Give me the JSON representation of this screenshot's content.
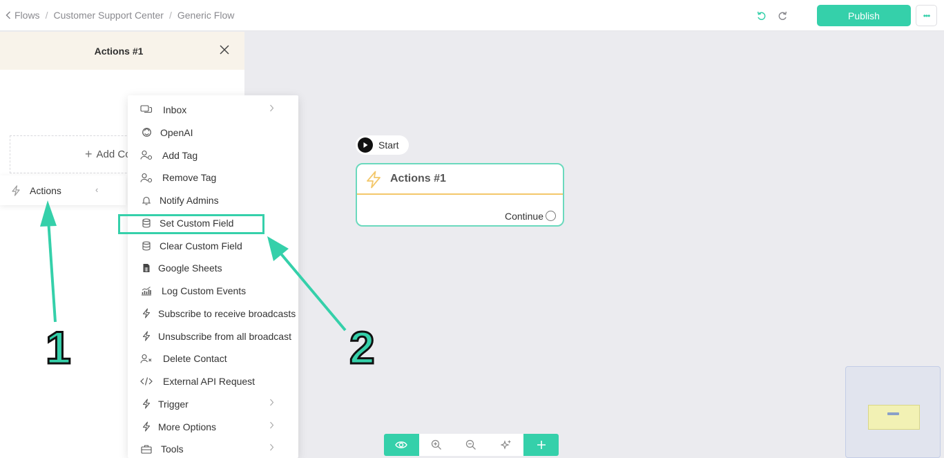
{
  "breadcrumb": {
    "back_label": "Flows",
    "items": [
      "Customer Support Center",
      "Generic Flow"
    ],
    "separator": "/"
  },
  "topbar": {
    "publish_label": "Publish",
    "more_glyph": "•••"
  },
  "panel": {
    "title": "Actions #1",
    "add_content_label": "Add Co",
    "actions_item_label": "Actions"
  },
  "menu": {
    "items": [
      {
        "label": "Inbox",
        "icon": "chat-bubbles-icon",
        "submenu": true
      },
      {
        "label": "OpenAI",
        "icon": "openai-icon",
        "submenu": false
      },
      {
        "label": "Add Tag",
        "icon": "user-tag-icon",
        "submenu": false
      },
      {
        "label": "Remove Tag",
        "icon": "user-tag-icon",
        "submenu": false
      },
      {
        "label": "Notify Admins",
        "icon": "bell-icon",
        "submenu": false
      },
      {
        "label": "Set Custom Field",
        "icon": "database-icon",
        "submenu": false
      },
      {
        "label": "Clear Custom Field",
        "icon": "database-icon",
        "submenu": false
      },
      {
        "label": "Google Sheets",
        "icon": "sheet-icon",
        "submenu": false
      },
      {
        "label": "Log Custom Events",
        "icon": "bar-chart-icon",
        "submenu": false
      },
      {
        "label": "Subscribe to receive broadcasts",
        "icon": "bolt-icon",
        "submenu": false
      },
      {
        "label": "Unsubscribe from all broadcast",
        "icon": "bolt-icon",
        "submenu": false
      },
      {
        "label": "Delete Contact",
        "icon": "user-delete-icon",
        "submenu": false
      },
      {
        "label": "External API Request",
        "icon": "code-icon",
        "submenu": false
      },
      {
        "label": "Trigger",
        "icon": "bolt-icon",
        "submenu": true
      },
      {
        "label": "More Options",
        "icon": "bolt-icon",
        "submenu": true
      },
      {
        "label": "Tools",
        "icon": "toolbox-icon",
        "submenu": true
      }
    ]
  },
  "canvas": {
    "start_label": "Start",
    "node_title": "Actions #1",
    "node_output_label": "Continue"
  },
  "annotations": {
    "step1": "1",
    "step2": "2"
  },
  "colors": {
    "accent": "#35d0aa",
    "node_divider": "#f3c76a",
    "panel_header_bg": "#f8f3ea"
  }
}
